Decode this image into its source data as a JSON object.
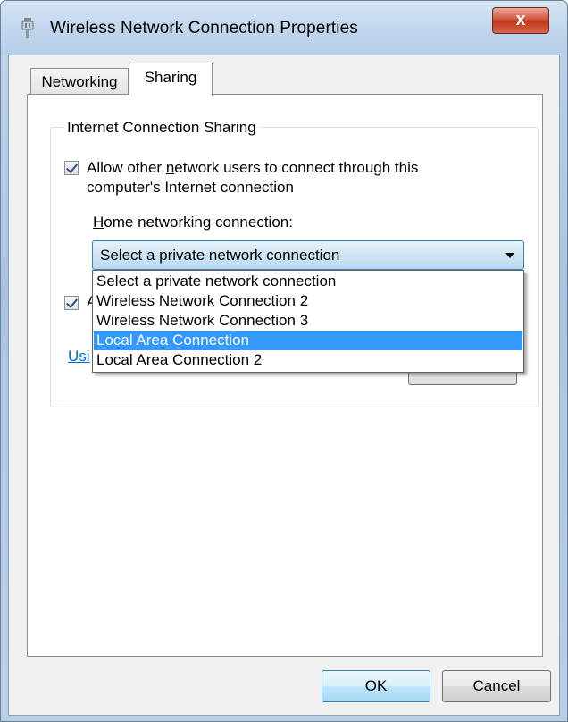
{
  "window": {
    "title": "Wireless Network Connection Properties",
    "close_glyph": "x"
  },
  "tabs": [
    {
      "label": "Networking",
      "active": false
    },
    {
      "label": "Sharing",
      "active": true
    }
  ],
  "sharing": {
    "group_title": "Internet Connection Sharing",
    "allow_connect": {
      "checked": true,
      "label_line1_before": "Allow other ",
      "label_line1_underlined": "n",
      "label_line1_after": "etwork users to connect through this",
      "label_line2": "computer's Internet connection"
    },
    "home_label_underlined": "H",
    "home_label_rest": "ome networking connection:",
    "select": {
      "value": "Select a private network connection",
      "options": [
        {
          "label": "Select a private network connection",
          "selected": false
        },
        {
          "label": "Wireless Network Connection 2",
          "selected": false
        },
        {
          "label": "Wireless Network Connection 3",
          "selected": false
        },
        {
          "label": "Local Area Connection",
          "selected": true
        },
        {
          "label": "Local Area Connection 2",
          "selected": false
        }
      ]
    },
    "second_checkbox": {
      "checked": true,
      "partial_line1": "A",
      "partial_line2": "s"
    },
    "partial_link": "Usi"
  },
  "footer": {
    "ok_label": "OK",
    "cancel_label": "Cancel"
  }
}
